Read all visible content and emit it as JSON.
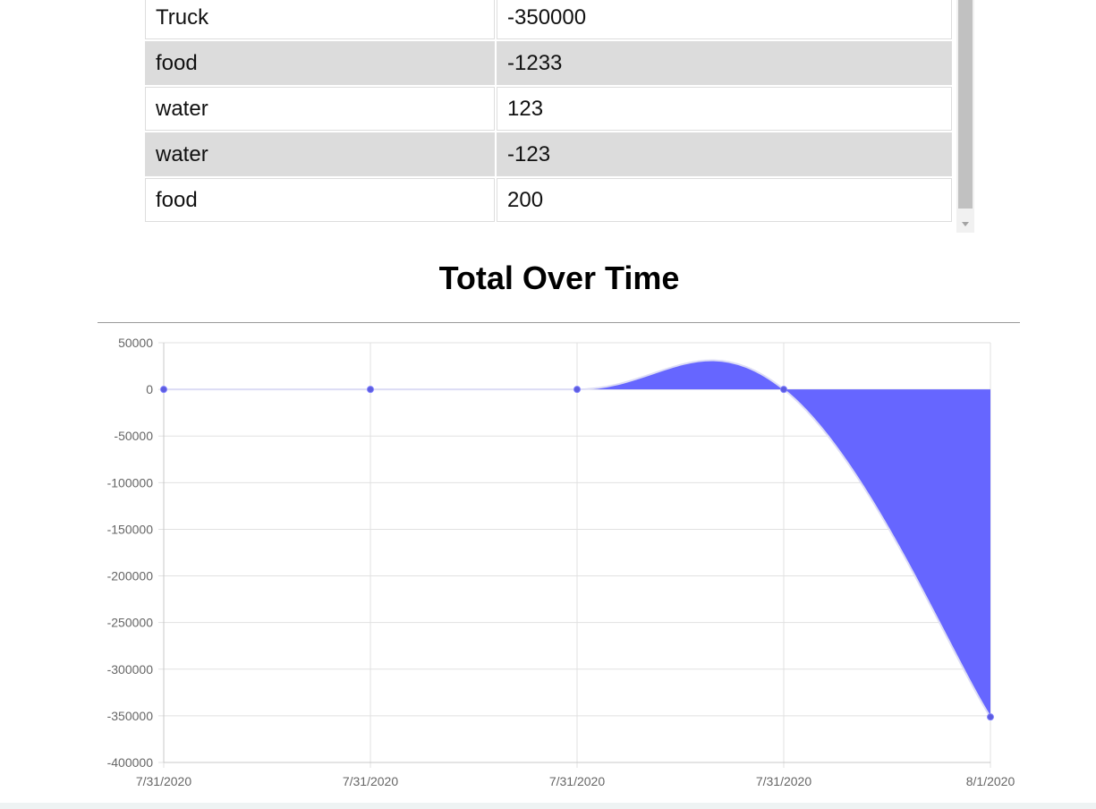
{
  "table": {
    "rows": [
      {
        "name": "Truck",
        "value": "-350000"
      },
      {
        "name": "food",
        "value": "-1233"
      },
      {
        "name": "water",
        "value": "123"
      },
      {
        "name": "water",
        "value": "-123"
      },
      {
        "name": "food",
        "value": "200"
      }
    ]
  },
  "chart_title": "Total Over Time",
  "chart_data": {
    "type": "area",
    "title": "Total Over Time",
    "xlabel": "",
    "ylabel": "",
    "categories": [
      "7/31/2020",
      "7/31/2020",
      "7/31/2020",
      "7/31/2020",
      "8/1/2020"
    ],
    "series": [
      {
        "values": [
          0,
          0,
          0,
          0,
          -351233
        ]
      }
    ],
    "ylim": [
      -400000,
      50000
    ],
    "yticks": [
      "50000",
      "0",
      "-50000",
      "-100000",
      "-150000",
      "-200000",
      "-250000",
      "-300000",
      "-350000",
      "-400000"
    ],
    "grid": true,
    "fill_color": "#6666ff",
    "line_color": "#dcdcf5",
    "point_color": "#5c5ce0"
  }
}
